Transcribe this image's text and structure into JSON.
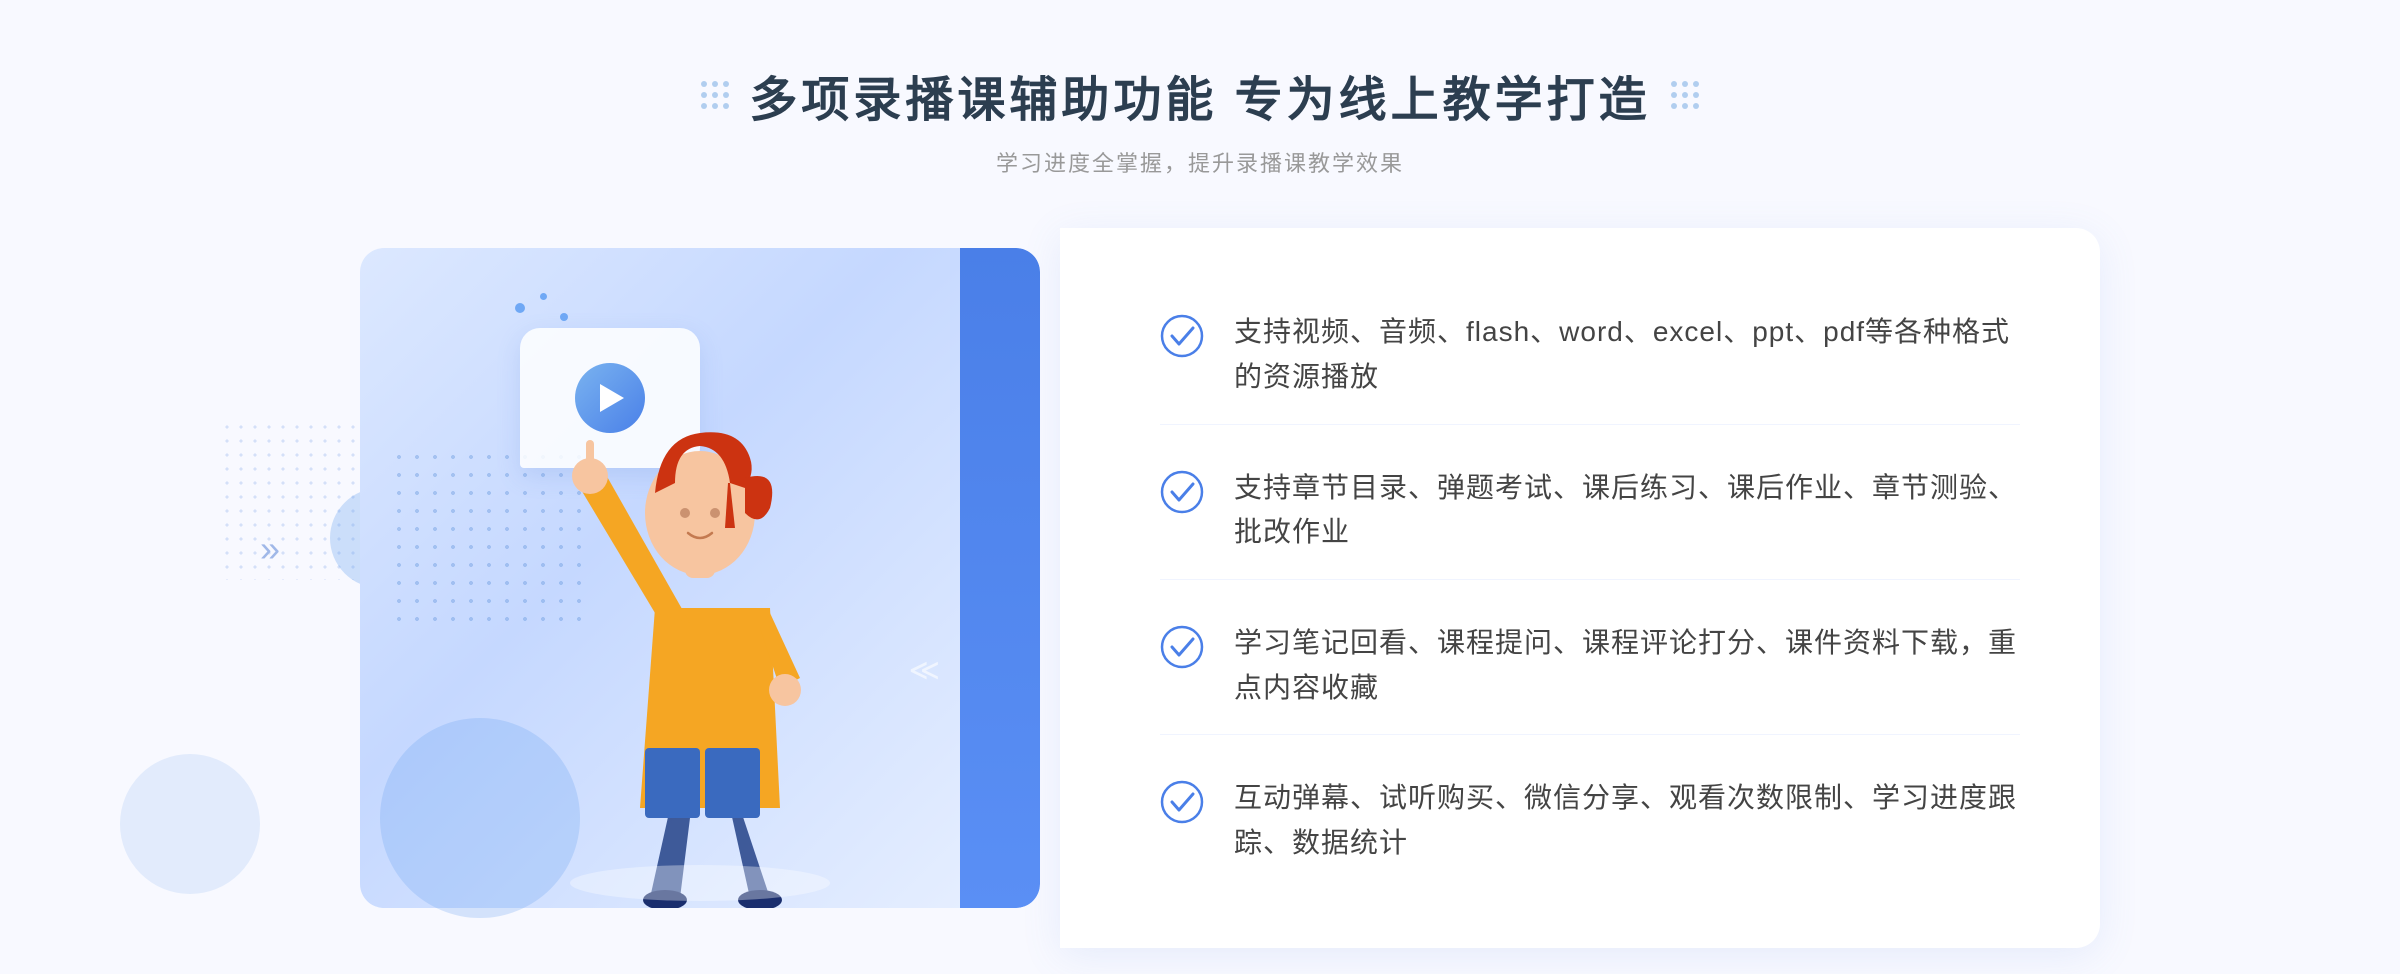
{
  "header": {
    "title": "多项录播课辅助功能 专为线上教学打造",
    "subtitle": "学习进度全掌握，提升录播课教学效果"
  },
  "features": [
    {
      "id": "feature-1",
      "text": "支持视频、音频、flash、word、excel、ppt、pdf等各种格式的资源播放"
    },
    {
      "id": "feature-2",
      "text": "支持章节目录、弹题考试、课后练习、课后作业、章节测验、批改作业"
    },
    {
      "id": "feature-3",
      "text": "学习笔记回看、课程提问、课程评论打分、课件资料下载，重点内容收藏"
    },
    {
      "id": "feature-4",
      "text": "互动弹幕、试听购买、微信分享、观看次数限制、学习进度跟踪、数据统计"
    }
  ],
  "colors": {
    "accent_blue": "#4a7fe8",
    "light_blue": "#dce8ff",
    "text_dark": "#2c3e50",
    "text_gray": "#999999",
    "text_feature": "#444444",
    "check_blue": "#4a7fe8"
  }
}
